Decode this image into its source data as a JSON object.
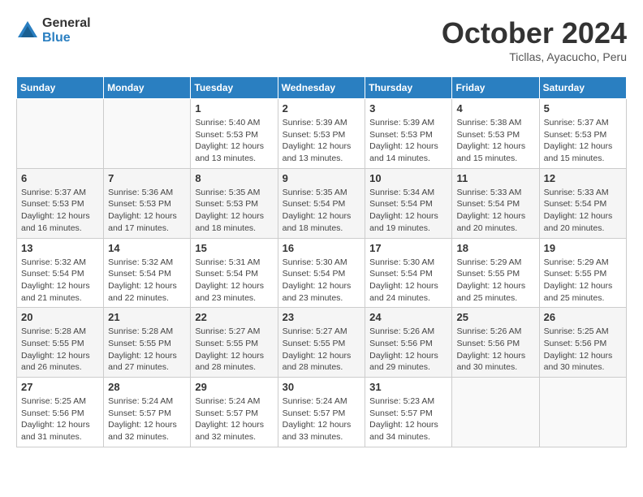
{
  "header": {
    "logo_general": "General",
    "logo_blue": "Blue",
    "month_title": "October 2024",
    "location": "Ticllas, Ayacucho, Peru"
  },
  "weekdays": [
    "Sunday",
    "Monday",
    "Tuesday",
    "Wednesday",
    "Thursday",
    "Friday",
    "Saturday"
  ],
  "weeks": [
    [
      {
        "day": "",
        "sunrise": "",
        "sunset": "",
        "daylight": ""
      },
      {
        "day": "",
        "sunrise": "",
        "sunset": "",
        "daylight": ""
      },
      {
        "day": "1",
        "sunrise": "Sunrise: 5:40 AM",
        "sunset": "Sunset: 5:53 PM",
        "daylight": "Daylight: 12 hours and 13 minutes."
      },
      {
        "day": "2",
        "sunrise": "Sunrise: 5:39 AM",
        "sunset": "Sunset: 5:53 PM",
        "daylight": "Daylight: 12 hours and 13 minutes."
      },
      {
        "day": "3",
        "sunrise": "Sunrise: 5:39 AM",
        "sunset": "Sunset: 5:53 PM",
        "daylight": "Daylight: 12 hours and 14 minutes."
      },
      {
        "day": "4",
        "sunrise": "Sunrise: 5:38 AM",
        "sunset": "Sunset: 5:53 PM",
        "daylight": "Daylight: 12 hours and 15 minutes."
      },
      {
        "day": "5",
        "sunrise": "Sunrise: 5:37 AM",
        "sunset": "Sunset: 5:53 PM",
        "daylight": "Daylight: 12 hours and 15 minutes."
      }
    ],
    [
      {
        "day": "6",
        "sunrise": "Sunrise: 5:37 AM",
        "sunset": "Sunset: 5:53 PM",
        "daylight": "Daylight: 12 hours and 16 minutes."
      },
      {
        "day": "7",
        "sunrise": "Sunrise: 5:36 AM",
        "sunset": "Sunset: 5:53 PM",
        "daylight": "Daylight: 12 hours and 17 minutes."
      },
      {
        "day": "8",
        "sunrise": "Sunrise: 5:35 AM",
        "sunset": "Sunset: 5:53 PM",
        "daylight": "Daylight: 12 hours and 18 minutes."
      },
      {
        "day": "9",
        "sunrise": "Sunrise: 5:35 AM",
        "sunset": "Sunset: 5:54 PM",
        "daylight": "Daylight: 12 hours and 18 minutes."
      },
      {
        "day": "10",
        "sunrise": "Sunrise: 5:34 AM",
        "sunset": "Sunset: 5:54 PM",
        "daylight": "Daylight: 12 hours and 19 minutes."
      },
      {
        "day": "11",
        "sunrise": "Sunrise: 5:33 AM",
        "sunset": "Sunset: 5:54 PM",
        "daylight": "Daylight: 12 hours and 20 minutes."
      },
      {
        "day": "12",
        "sunrise": "Sunrise: 5:33 AM",
        "sunset": "Sunset: 5:54 PM",
        "daylight": "Daylight: 12 hours and 20 minutes."
      }
    ],
    [
      {
        "day": "13",
        "sunrise": "Sunrise: 5:32 AM",
        "sunset": "Sunset: 5:54 PM",
        "daylight": "Daylight: 12 hours and 21 minutes."
      },
      {
        "day": "14",
        "sunrise": "Sunrise: 5:32 AM",
        "sunset": "Sunset: 5:54 PM",
        "daylight": "Daylight: 12 hours and 22 minutes."
      },
      {
        "day": "15",
        "sunrise": "Sunrise: 5:31 AM",
        "sunset": "Sunset: 5:54 PM",
        "daylight": "Daylight: 12 hours and 23 minutes."
      },
      {
        "day": "16",
        "sunrise": "Sunrise: 5:30 AM",
        "sunset": "Sunset: 5:54 PM",
        "daylight": "Daylight: 12 hours and 23 minutes."
      },
      {
        "day": "17",
        "sunrise": "Sunrise: 5:30 AM",
        "sunset": "Sunset: 5:54 PM",
        "daylight": "Daylight: 12 hours and 24 minutes."
      },
      {
        "day": "18",
        "sunrise": "Sunrise: 5:29 AM",
        "sunset": "Sunset: 5:55 PM",
        "daylight": "Daylight: 12 hours and 25 minutes."
      },
      {
        "day": "19",
        "sunrise": "Sunrise: 5:29 AM",
        "sunset": "Sunset: 5:55 PM",
        "daylight": "Daylight: 12 hours and 25 minutes."
      }
    ],
    [
      {
        "day": "20",
        "sunrise": "Sunrise: 5:28 AM",
        "sunset": "Sunset: 5:55 PM",
        "daylight": "Daylight: 12 hours and 26 minutes."
      },
      {
        "day": "21",
        "sunrise": "Sunrise: 5:28 AM",
        "sunset": "Sunset: 5:55 PM",
        "daylight": "Daylight: 12 hours and 27 minutes."
      },
      {
        "day": "22",
        "sunrise": "Sunrise: 5:27 AM",
        "sunset": "Sunset: 5:55 PM",
        "daylight": "Daylight: 12 hours and 28 minutes."
      },
      {
        "day": "23",
        "sunrise": "Sunrise: 5:27 AM",
        "sunset": "Sunset: 5:55 PM",
        "daylight": "Daylight: 12 hours and 28 minutes."
      },
      {
        "day": "24",
        "sunrise": "Sunrise: 5:26 AM",
        "sunset": "Sunset: 5:56 PM",
        "daylight": "Daylight: 12 hours and 29 minutes."
      },
      {
        "day": "25",
        "sunrise": "Sunrise: 5:26 AM",
        "sunset": "Sunset: 5:56 PM",
        "daylight": "Daylight: 12 hours and 30 minutes."
      },
      {
        "day": "26",
        "sunrise": "Sunrise: 5:25 AM",
        "sunset": "Sunset: 5:56 PM",
        "daylight": "Daylight: 12 hours and 30 minutes."
      }
    ],
    [
      {
        "day": "27",
        "sunrise": "Sunrise: 5:25 AM",
        "sunset": "Sunset: 5:56 PM",
        "daylight": "Daylight: 12 hours and 31 minutes."
      },
      {
        "day": "28",
        "sunrise": "Sunrise: 5:24 AM",
        "sunset": "Sunset: 5:57 PM",
        "daylight": "Daylight: 12 hours and 32 minutes."
      },
      {
        "day": "29",
        "sunrise": "Sunrise: 5:24 AM",
        "sunset": "Sunset: 5:57 PM",
        "daylight": "Daylight: 12 hours and 32 minutes."
      },
      {
        "day": "30",
        "sunrise": "Sunrise: 5:24 AM",
        "sunset": "Sunset: 5:57 PM",
        "daylight": "Daylight: 12 hours and 33 minutes."
      },
      {
        "day": "31",
        "sunrise": "Sunrise: 5:23 AM",
        "sunset": "Sunset: 5:57 PM",
        "daylight": "Daylight: 12 hours and 34 minutes."
      },
      {
        "day": "",
        "sunrise": "",
        "sunset": "",
        "daylight": ""
      },
      {
        "day": "",
        "sunrise": "",
        "sunset": "",
        "daylight": ""
      }
    ]
  ]
}
